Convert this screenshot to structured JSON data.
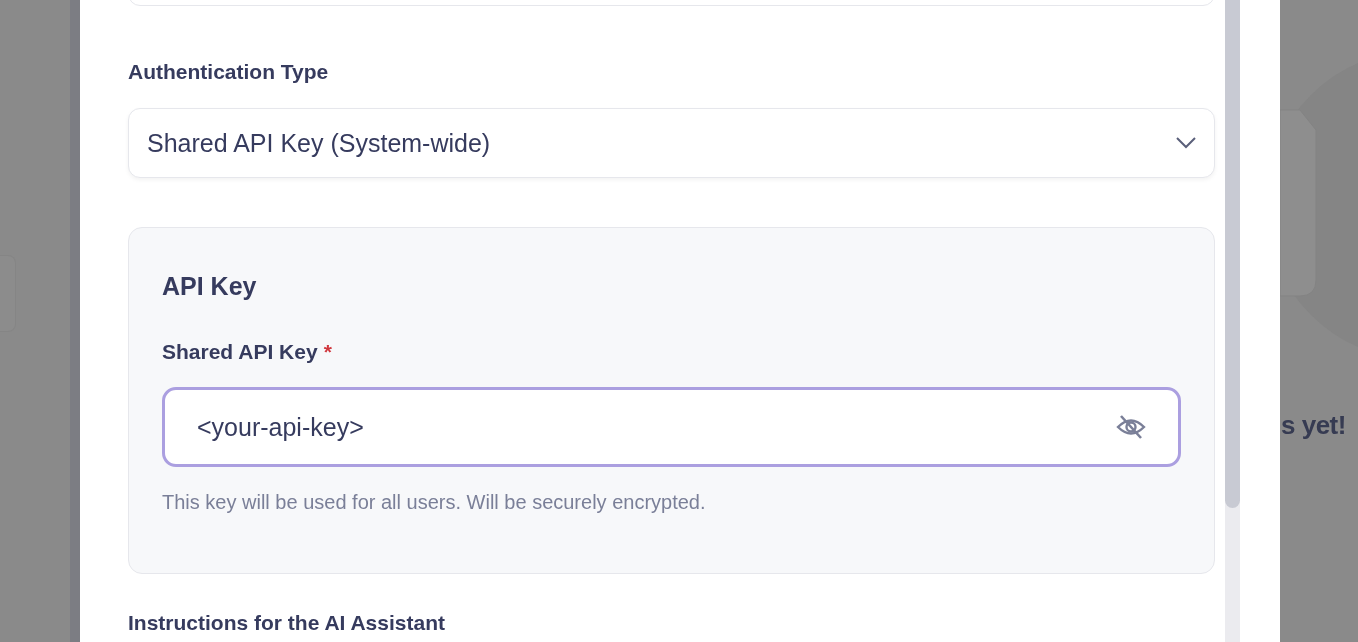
{
  "auth": {
    "label": "Authentication Type",
    "select_value": "Shared API Key (System-wide)"
  },
  "api_key_panel": {
    "title": "API Key",
    "field_label": "Shared API Key",
    "required": true,
    "required_mark": "*",
    "value": "<your-api-key>",
    "hint": "This key will be used for all users. Will be securely encrypted."
  },
  "next_section": {
    "label": "Instructions for the AI Assistant"
  },
  "background": {
    "empty_state_text": "s yet!"
  }
}
